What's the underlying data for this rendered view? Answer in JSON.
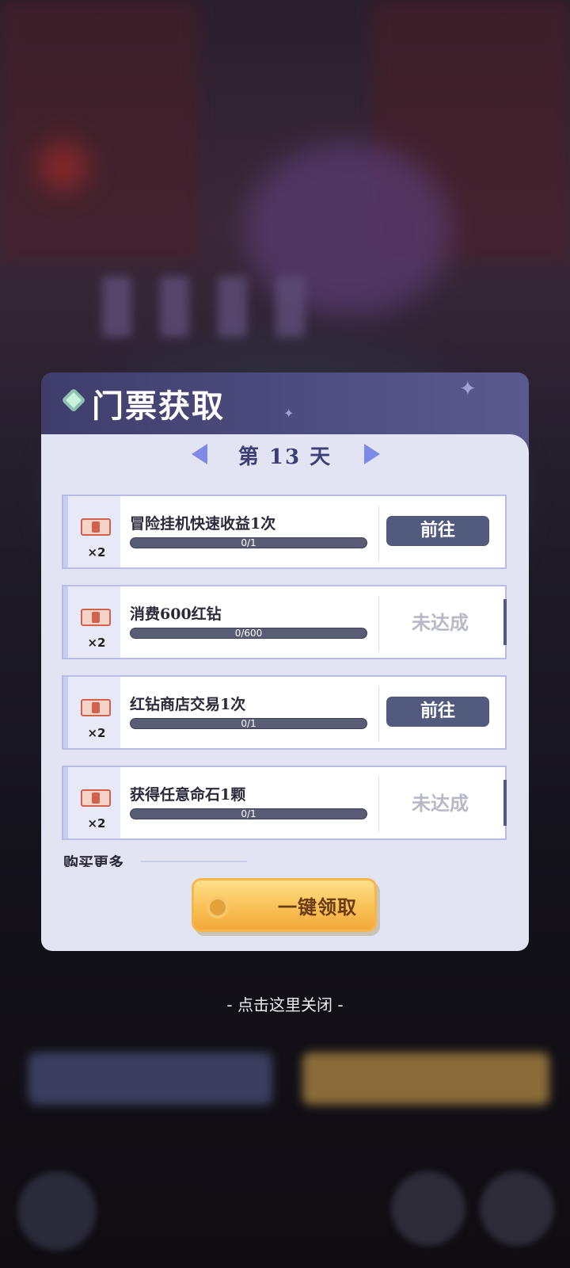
{
  "dialog": {
    "title": "门票获取",
    "day_label": "第 13 天",
    "tasks": [
      {
        "title": "冒险挂机快速收益1次",
        "reward_count": "×2",
        "progress_text": "0/1",
        "progress": 0,
        "action": "前往",
        "action_type": "button"
      },
      {
        "title": "消费600红钻",
        "reward_count": "×2",
        "progress_text": "0/600",
        "progress": 0,
        "action": "未达成",
        "action_type": "status"
      },
      {
        "title": "红钻商店交易1次",
        "reward_count": "×2",
        "progress_text": "0/1",
        "progress": 0,
        "action": "前往",
        "action_type": "button"
      },
      {
        "title": "获得任意命石1颗",
        "reward_count": "×2",
        "progress_text": "0/1",
        "progress": 0,
        "action": "未达成",
        "action_type": "status"
      }
    ],
    "more_label": "购买更多",
    "claim_all_label": "一键领取"
  },
  "close_hint": "- 点击这里关闭 -",
  "icons": {
    "header": "gem-icon",
    "prev": "arrow-left-icon",
    "next": "arrow-right-icon",
    "reward": "ticket-icon",
    "claim": "coin-icon"
  },
  "colors": {
    "header_bg": "#4e4d80",
    "body_bg": "#e3e4f3",
    "accent_arrow": "#7f89e6",
    "go_button": "#525a7e",
    "claim_button": "#f9c156",
    "not_done_text": "#b7b9c7"
  }
}
